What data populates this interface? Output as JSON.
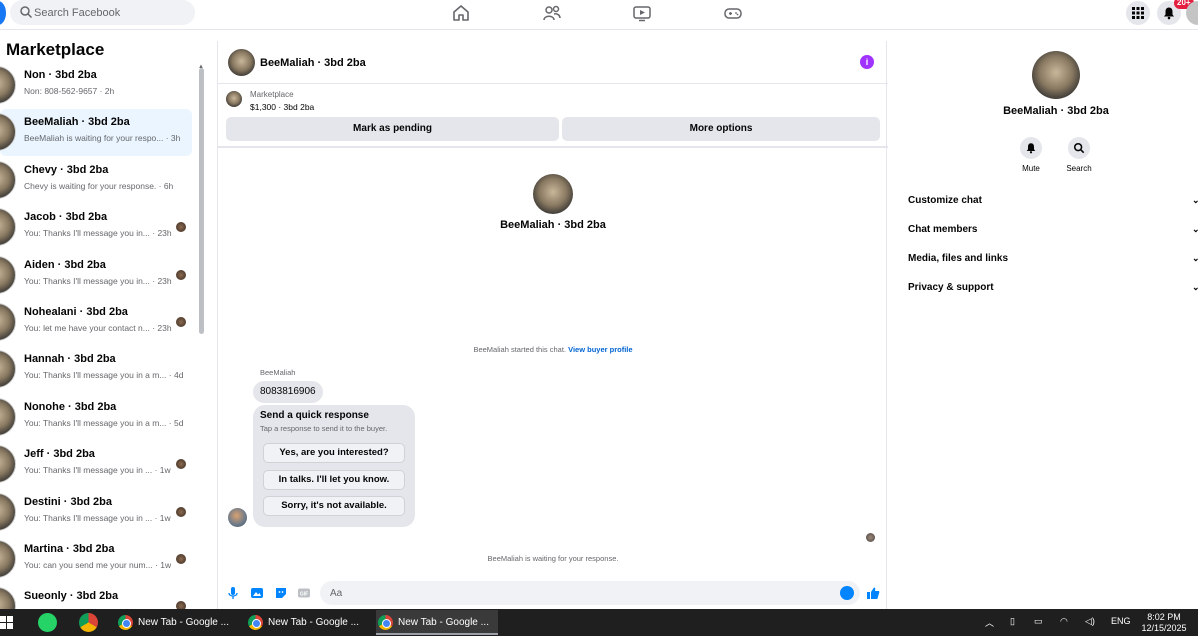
{
  "topbar": {
    "search_placeholder": "Search Facebook",
    "notification_badge": "20+"
  },
  "sidebar": {
    "title": "Marketplace",
    "conversations": [
      {
        "name": "Non · 3bd 2ba",
        "snippet": "Non: 808-562-9657 · 2h"
      },
      {
        "name": "BeeMaliah · 3bd 2ba",
        "snippet": "BeeMaliah is waiting for your respo... · 3h"
      },
      {
        "name": "Chevy · 3bd 2ba",
        "snippet": "Chevy is waiting for your response. · 6h"
      },
      {
        "name": "Jacob · 3bd 2ba",
        "snippet": "You: Thanks I'll message you in... · 23h"
      },
      {
        "name": "Aiden · 3bd 2ba",
        "snippet": "You: Thanks I'll message you in... · 23h"
      },
      {
        "name": "Nohealani · 3bd 2ba",
        "snippet": "You: let me have your contact n... · 23h"
      },
      {
        "name": "Hannah · 3bd 2ba",
        "snippet": "You: Thanks I'll message you in a m... · 4d"
      },
      {
        "name": "Nonohe · 3bd 2ba",
        "snippet": "You: Thanks I'll message you in a m... · 5d"
      },
      {
        "name": "Jeff · 3bd 2ba",
        "snippet": "You: Thanks I'll message you in ... · 1w"
      },
      {
        "name": "Destini · 3bd 2ba",
        "snippet": "You: Thanks I'll message you in ... · 1w"
      },
      {
        "name": "Martina · 3bd 2ba",
        "snippet": "You: can you send me your num... · 1w"
      },
      {
        "name": "Sueonly · 3bd 2ba",
        "snippet": ""
      }
    ]
  },
  "chat": {
    "title": "BeeMaliah · 3bd 2ba",
    "listing_label": "Marketplace",
    "listing_price": "$1,300 · 3bd 2ba",
    "mark_pending": "Mark as pending",
    "more_options": "More options",
    "center_name": "BeeMaliah · 3bd 2ba",
    "started_note": "BeeMaliah started this chat.",
    "view_profile": "View buyer profile",
    "sender_label": "BeeMaliah",
    "message": "8083816906",
    "quick_title": "Send a quick response",
    "quick_subtitle": "Tap a response to send it to the buyer.",
    "quick_options": [
      "Yes, are you interested?",
      "In talks. I'll let you know.",
      "Sorry, it's not available."
    ],
    "waiting_note": "BeeMaliah is waiting for your response.",
    "composer_placeholder": "Aa"
  },
  "right_panel": {
    "name": "BeeMaliah · 3bd 2ba",
    "mute_label": "Mute",
    "search_label": "Search",
    "menu": [
      "Customize chat",
      "Chat members",
      "Media, files and links",
      "Privacy & support"
    ]
  },
  "taskbar": {
    "tabs": [
      "New Tab - Google ...",
      "New Tab - Google ...",
      "New Tab - Google ..."
    ],
    "language": "ENG",
    "time": "8:02 PM",
    "date": "12/15/2025"
  }
}
